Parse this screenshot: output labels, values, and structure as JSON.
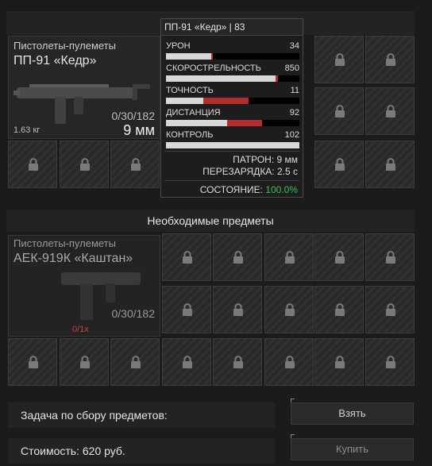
{
  "upper_weapon": {
    "category": "Пистолеты-пулеметы",
    "name": "ПП-91 «Кедр»",
    "ammo": "0/30/182",
    "caliber": "9 мм",
    "weight": "1.63 кг"
  },
  "tooltip": {
    "title": "ПП-91 «Кедр» | 83",
    "stats": [
      {
        "label": "УРОН",
        "value": "34",
        "fill": 0.34,
        "red_to": 0.35
      },
      {
        "label": "СКОРОСТРЕЛЬНОСТЬ",
        "value": "850",
        "fill": 0.82,
        "red_to": 0.84
      },
      {
        "label": "ТОЧНОСТЬ",
        "value": "11",
        "fill": 0.28,
        "red_to": 0.62
      },
      {
        "label": "ДИСТАНЦИЯ",
        "value": "92",
        "fill": 0.46,
        "red_to": 0.72
      },
      {
        "label": "КОНТРОЛЬ",
        "value": "102",
        "fill": 1.0,
        "red_to": 1.0
      }
    ],
    "cartridge": "ПАТРОН: 9 мм",
    "reload": "ПЕРЕЗАРЯДКА: 2.5 с",
    "condition_label": "СОСТОЯНИЕ:",
    "condition_value": "100.0%",
    "condition_color": "#3fbf57"
  },
  "required_section": {
    "title": "Необходимые предметы"
  },
  "required_weapon": {
    "category": "Пистолеты-пулеметы",
    "name": "АЕК-919К «Каштан»",
    "ammo": "0/30/182",
    "count": "0/1x",
    "count_color": "#c9463d"
  },
  "footer": {
    "task_label": "Задача по сбору предметов:",
    "cost_label": "Стоимость: 620 руб.",
    "take_button": "Взять",
    "buy_button": "Купить"
  },
  "icons": {
    "lock": "lock-icon",
    "weapon": "smg-icon"
  }
}
